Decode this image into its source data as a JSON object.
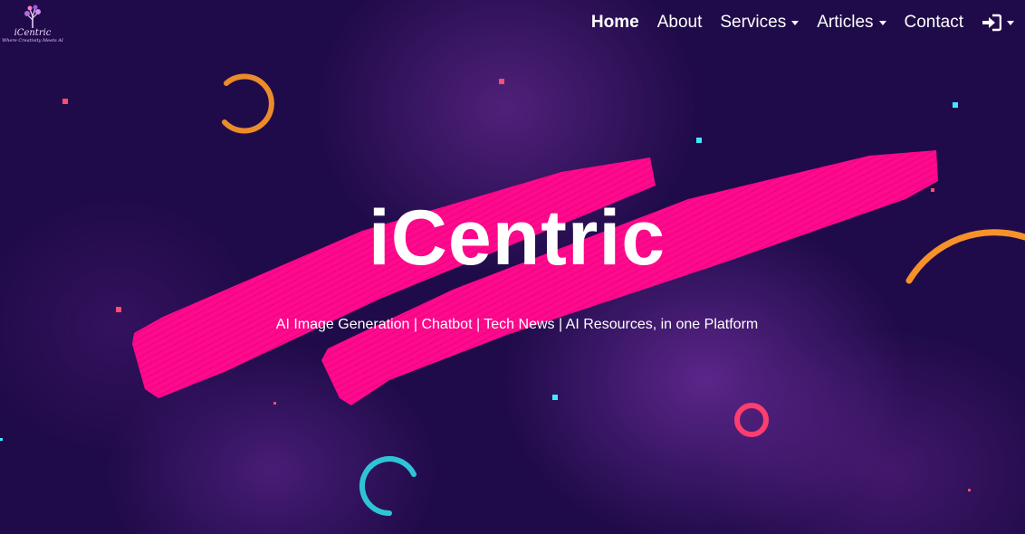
{
  "brand": {
    "name": "iCentric",
    "tagline": "Where Creativity Meets AI"
  },
  "nav": {
    "items": [
      {
        "label": "Home",
        "active": true,
        "dropdown": false
      },
      {
        "label": "About",
        "active": false,
        "dropdown": false
      },
      {
        "label": "Services",
        "active": false,
        "dropdown": true
      },
      {
        "label": "Articles",
        "active": false,
        "dropdown": true
      },
      {
        "label": "Contact",
        "active": false,
        "dropdown": false
      }
    ],
    "login_icon": "sign-in-icon"
  },
  "hero": {
    "title": "iCentric",
    "subtitle": "AI Image Generation | Chatbot | Tech News | AI Resources, in one Platform"
  },
  "colors": {
    "background": "#200b4a",
    "brush": "#ff0a8c",
    "ring_orange": "#f7922a",
    "ring_pink": "#ff3d6e",
    "ring_teal": "#2ec4d6",
    "square_cyan": "#3ee8ff",
    "square_red": "#ff4d6d"
  }
}
